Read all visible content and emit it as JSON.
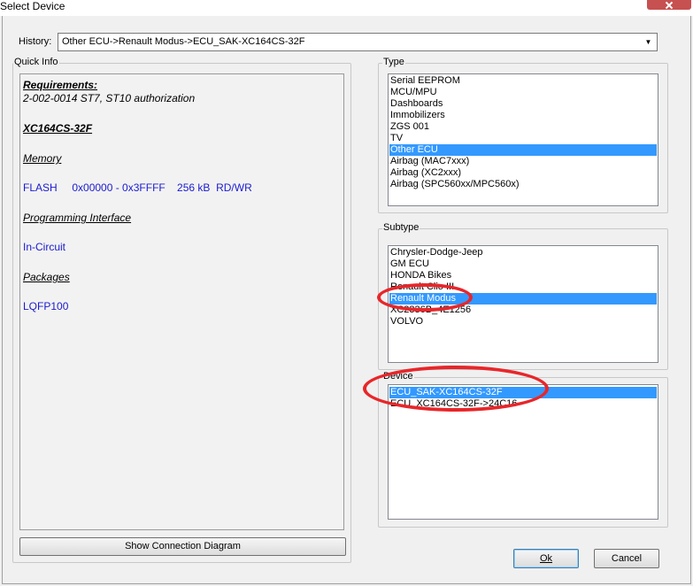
{
  "window": {
    "title": "Select Device"
  },
  "history": {
    "label": "History:",
    "value": "Other ECU->Renault Modus->ECU_SAK-XC164CS-32F"
  },
  "quick_info": {
    "group_title": "Quick Info",
    "requirements_heading": "Requirements:",
    "requirements_text": "2-002-0014  ST7, ST10 authorization",
    "device_name": "XC164CS-32F",
    "memory_heading": "Memory",
    "memory_line": "FLASH     0x00000 - 0x3FFFF    256 kB  RD/WR",
    "programming_heading": "Programming Interface",
    "programming_value": "In-Circuit",
    "packages_heading": "Packages",
    "packages_value": "LQFP100",
    "connection_button": "Show Connection Diagram"
  },
  "type": {
    "group_title": "Type",
    "items": [
      "Serial EEPROM",
      "MCU/MPU",
      "Dashboards",
      "Immobilizers",
      "ZGS 001",
      "TV",
      "Other ECU",
      "Airbag (MAC7xxx)",
      "Airbag (XC2xxx)",
      "Airbag (SPC560xx/MPC560x)"
    ],
    "selected_index": 6
  },
  "subtype": {
    "group_title": "Subtype",
    "items": [
      "Chrysler-Dodge-Jeep",
      "GM ECU",
      "HONDA Bikes",
      "Renault Clio III",
      "Renault Modus",
      "XC2336B_4E1256",
      "VOLVO"
    ],
    "selected_index": 4
  },
  "device": {
    "group_title": "Device",
    "items": [
      "ECU_SAK-XC164CS-32F",
      "ECU_XC164CS-32F->24C16"
    ],
    "selected_index": 0
  },
  "buttons": {
    "ok": "Ok",
    "cancel": "Cancel"
  },
  "colors": {
    "selection": "#3399ff",
    "highlight_ellipse": "#e8262a",
    "info_text": "#1a1ad0"
  }
}
